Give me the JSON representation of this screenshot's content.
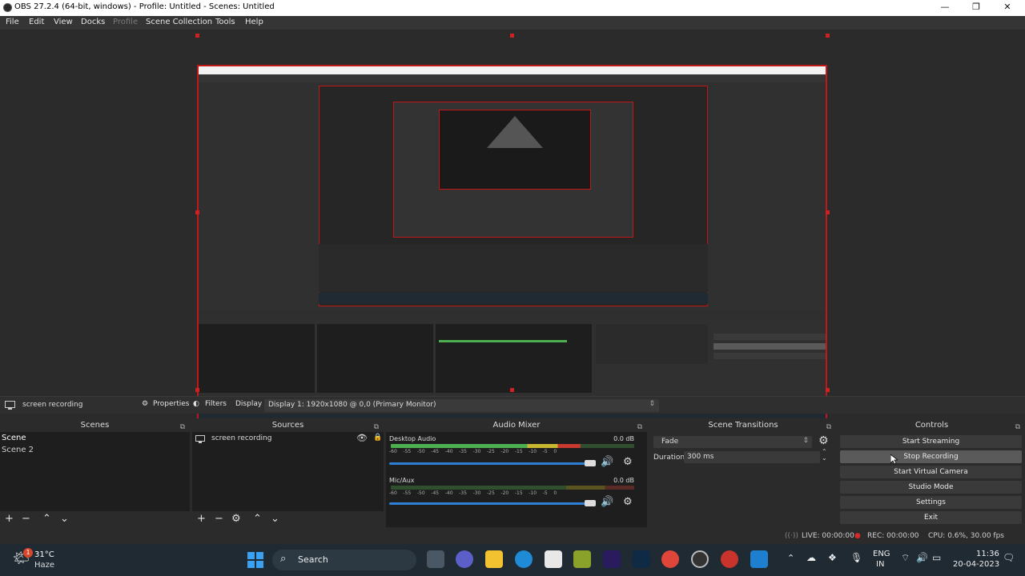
{
  "window": {
    "title": "OBS 27.2.4 (64-bit, windows) - Profile: Untitled - Scenes: Untitled",
    "minimize": "—",
    "maximize": "❐",
    "close": "✕"
  },
  "menu": [
    "File",
    "Edit",
    "View",
    "Docks",
    "Profile",
    "Scene Collection",
    "Tools",
    "Help"
  ],
  "preview_toolbar": {
    "source_name": "screen recording",
    "properties_label": "Properties",
    "filters_label": "Filters",
    "display_label": "Display",
    "display_value": "Display 1: 1920x1080 @ 0,0 (Primary Monitor)"
  },
  "scenes": {
    "title": "Scenes",
    "items": [
      "Scene",
      "Scene 2"
    ]
  },
  "sources": {
    "title": "Sources",
    "items": [
      "screen recording"
    ]
  },
  "audio_mixer": {
    "title": "Audio Mixer",
    "channels": [
      {
        "name": "Desktop Audio",
        "db": "0.0 dB",
        "level": 0.78
      },
      {
        "name": "Mic/Aux",
        "db": "0.0 dB",
        "level": 0.0
      }
    ],
    "ticks": [
      "-60",
      "-55",
      "-50",
      "-45",
      "-40",
      "-35",
      "-30",
      "-25",
      "-20",
      "-15",
      "-10",
      "-5",
      "0"
    ]
  },
  "scene_transitions": {
    "title": "Scene Transitions",
    "transition": "Fade",
    "duration_label": "Duration",
    "duration_value": "300 ms"
  },
  "controls": {
    "title": "Controls",
    "buttons": [
      "Start Streaming",
      "Stop Recording",
      "Start Virtual Camera",
      "Studio Mode",
      "Settings",
      "Exit"
    ]
  },
  "status": {
    "live": "LIVE: 00:00:00",
    "rec": "REC: 00:00:00",
    "cpu": "CPU: 0.6%, 30.00 fps"
  },
  "taskbar": {
    "weather_temp": "31°C",
    "weather_desc": "Haze",
    "weather_badge": "1",
    "search_label": "Search",
    "lang_top": "ENG",
    "lang_bottom": "IN",
    "time": "11:36",
    "date": "20-04-2023"
  },
  "colors": {
    "accent_red": "#c01818",
    "meter_green": "#4caf50",
    "meter_yellow": "#c8b830",
    "meter_red": "#c83a30",
    "slider_blue": "#2f7fd6"
  }
}
